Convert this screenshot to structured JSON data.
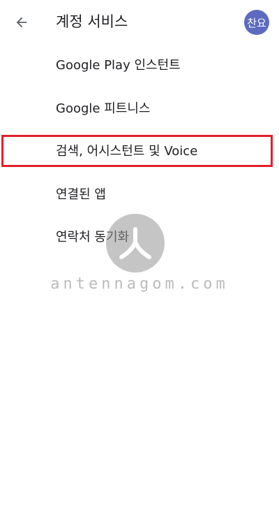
{
  "header": {
    "title": "계정 서비스",
    "back_icon": "arrow-left-icon",
    "avatar_text": "찬요",
    "avatar_color": "#5c6bc0"
  },
  "menu": {
    "items": [
      {
        "label": "Google Play 인스턴트"
      },
      {
        "label": "Google 피트니스"
      },
      {
        "label": "검색, 어시스턴트 및 Voice",
        "highlighted": true
      },
      {
        "label": "연결된 앱"
      },
      {
        "label": "연락처 동기화"
      }
    ]
  },
  "highlight_color": "#e21f2b",
  "watermark": {
    "text": "antennagom.com"
  }
}
